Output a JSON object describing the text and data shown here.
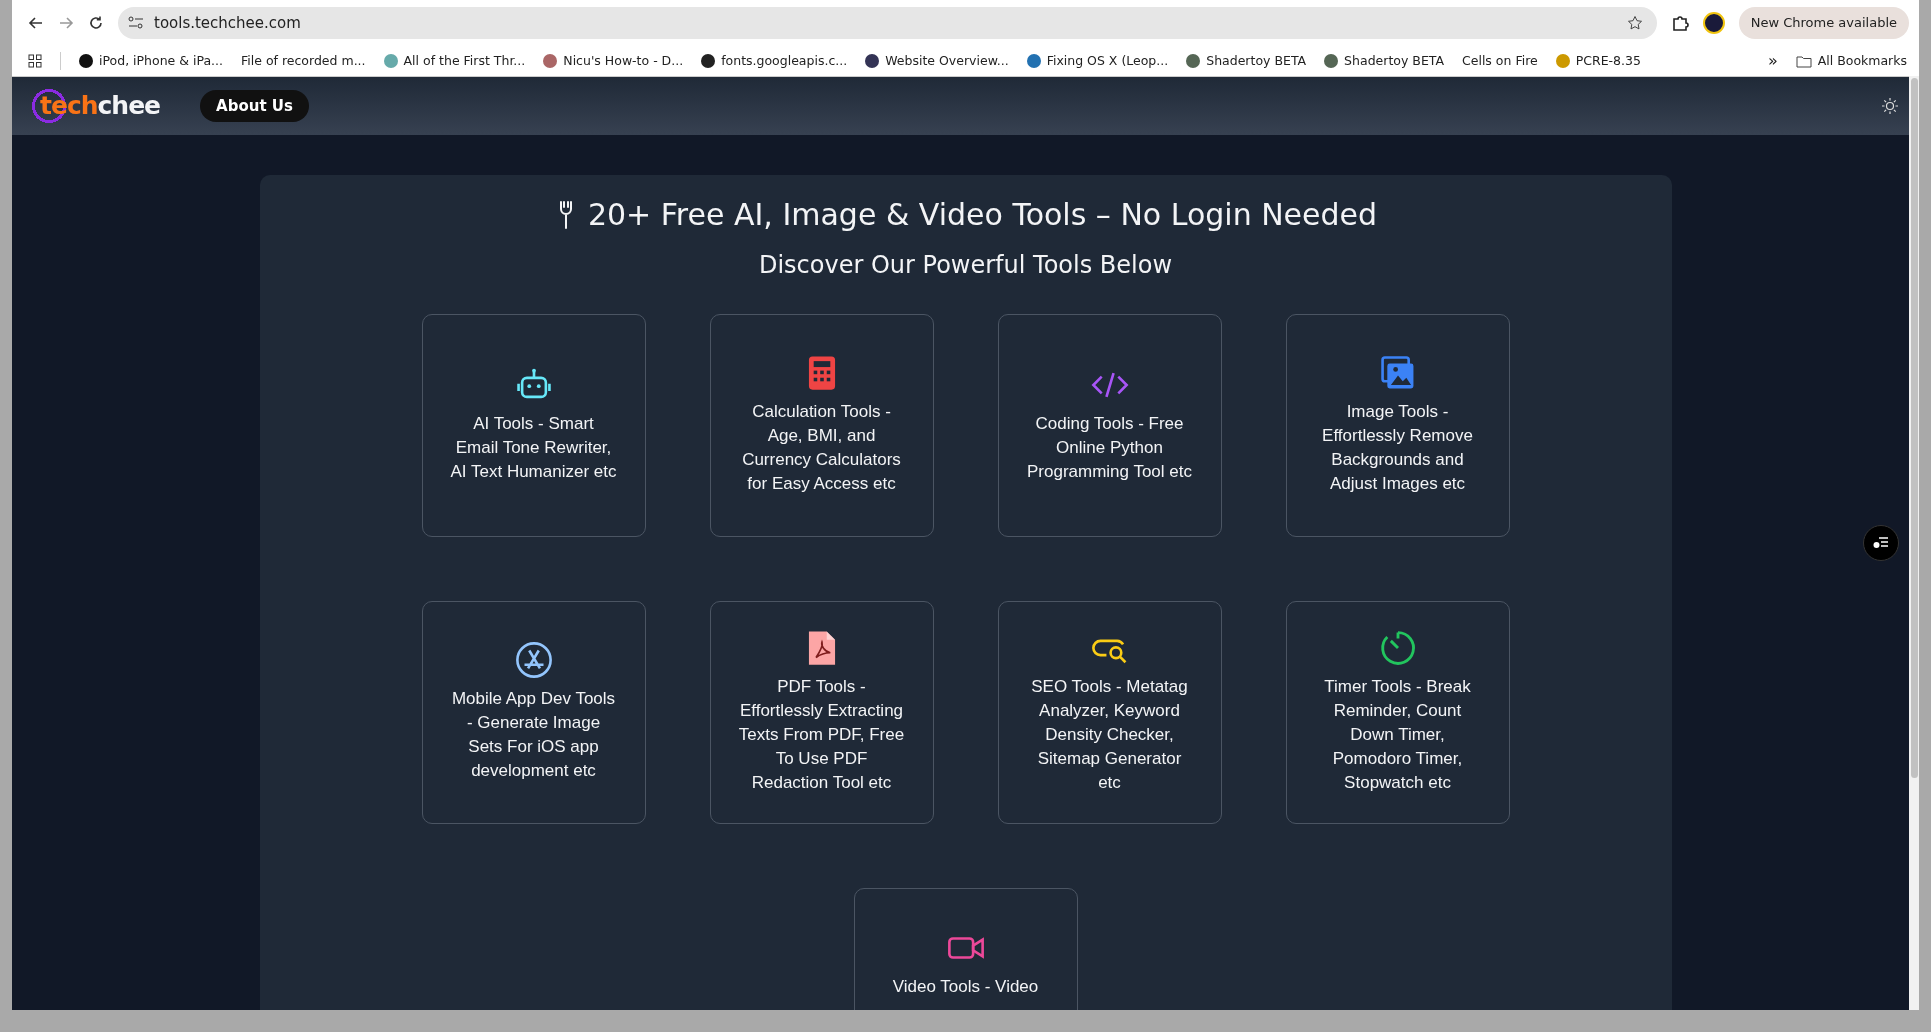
{
  "browser": {
    "url": "tools.techchee.com",
    "update_button": "New Chrome available",
    "bookmarks": [
      "iPod, iPhone & iPa...",
      "File of recorded m...",
      "All of the First Thr...",
      "Nicu's How-to - D...",
      "fonts.googleapis.c...",
      "Website Overview...",
      "Fixing OS X (Leop...",
      "Shadertoy BETA",
      "Shadertoy BETA",
      "Cells on Fire",
      "PCRE-8.35"
    ],
    "overflow": "»",
    "all_bookmarks": "All Bookmarks"
  },
  "navbar": {
    "logo": {
      "accent": "tech",
      "rest": "chee"
    },
    "links": [
      "About Us"
    ]
  },
  "hero": {
    "title": "20+ Free AI, Image & Video Tools – No Login Needed",
    "subtitle": "Discover Our Powerful Tools Below"
  },
  "tools": [
    {
      "text": "AI Tools - Smart Email Tone Rewriter, AI Text Humanizer etc",
      "color": "#67e8f9"
    },
    {
      "text": "Calculation Tools - Age, BMI, and Currency Calculators for Easy Access etc",
      "color": "#ef4444"
    },
    {
      "text": "Coding Tools - Free Online Python Programming Tool etc",
      "color": "#a855f7"
    },
    {
      "text": "Image Tools - Effortlessly Remove Backgrounds and Adjust Images etc",
      "color": "#3b82f6"
    },
    {
      "text": "Mobile App Dev Tools - Generate Image Sets For iOS app development etc",
      "color": "#93c5fd"
    },
    {
      "text": "PDF Tools - Effortlessly Extracting Texts From PDF, Free To Use PDF Redaction Tool etc",
      "color": "#fca5a5"
    },
    {
      "text": "SEO Tools - Metatag Analyzer, Keyword Density Checker, Sitemap Generator etc",
      "color": "#facc15"
    },
    {
      "text": "Timer Tools - Break Reminder, Count Down Timer, Pomodoro Timer, Stopwatch etc",
      "color": "#22c55e"
    },
    {
      "text": "Video Tools - Video",
      "color": "#ec4899"
    }
  ]
}
